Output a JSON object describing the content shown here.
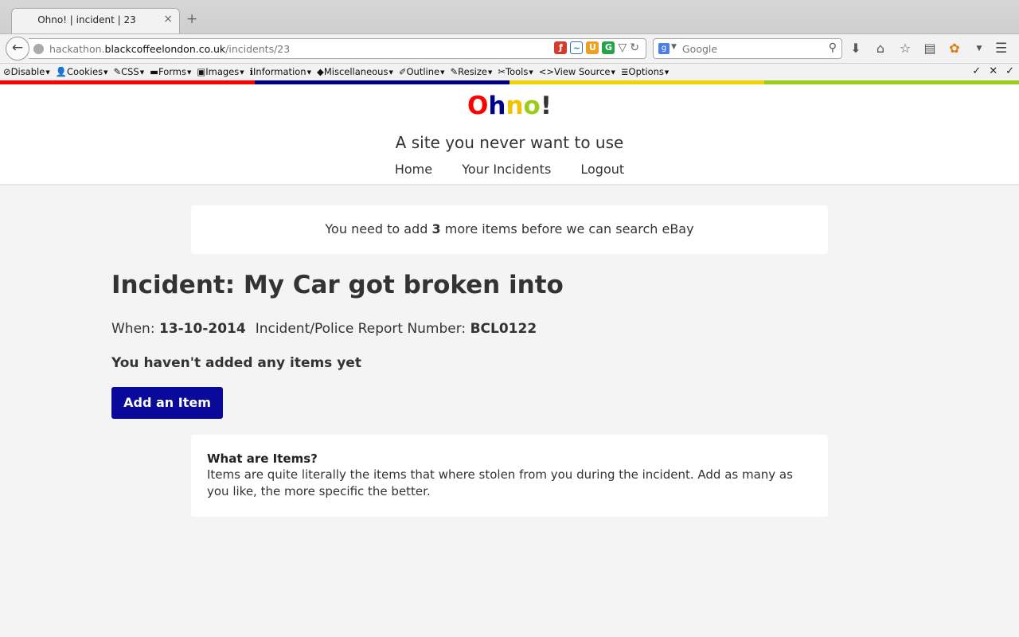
{
  "browser": {
    "tab_title": "Ohno! | incident | 23",
    "tab_close": "×",
    "new_tab": "+",
    "back": "←",
    "url": {
      "prefix": "hackathon.",
      "domain": "blackcoffeelondon.co.uk",
      "path": "/incidents/23"
    },
    "search_placeholder": "Google",
    "search_engine_letter": "g",
    "reload": "↻",
    "url_dropdown": "▽"
  },
  "dev_toolbar": {
    "items": [
      {
        "icon": "⊘",
        "label": "Disable"
      },
      {
        "icon": "👤",
        "label": "Cookies"
      },
      {
        "icon": "✎",
        "label": "CSS"
      },
      {
        "icon": "▬",
        "label": "Forms"
      },
      {
        "icon": "▣",
        "label": "Images"
      },
      {
        "icon": "ℹ",
        "label": "Information"
      },
      {
        "icon": "◆",
        "label": "Miscellaneous"
      },
      {
        "icon": "✐",
        "label": "Outline"
      },
      {
        "icon": "✎",
        "label": "Resize"
      },
      {
        "icon": "✂",
        "label": "Tools"
      },
      {
        "icon": "<>",
        "label": "View Source"
      },
      {
        "icon": "≣",
        "label": "Options"
      }
    ],
    "right": [
      "✓",
      "✕",
      "✓"
    ]
  },
  "strip_colors": [
    "#ff0000",
    "#00008b",
    "#f2d200",
    "#9ccc1a"
  ],
  "site": {
    "logo": {
      "o": "O",
      "h": "h",
      "n": "n",
      "o2": "o",
      "bang": "!"
    },
    "logo_colors": {
      "o": "#ff0000",
      "h": "#00008b",
      "n": "#f2c200",
      "o2": "#9ccc1a",
      "bang": "#333333"
    },
    "tagline": "A site you never want to use",
    "nav": [
      "Home",
      "Your Incidents",
      "Logout"
    ]
  },
  "notice": {
    "before": "You need to add ",
    "count": "3",
    "after": " more items before we can search eBay"
  },
  "incident": {
    "title": "Incident: My Car got broken into",
    "when_label": "When: ",
    "when_value": "13-10-2014",
    "report_label": "Incident/Police Report Number: ",
    "report_value": "BCL0122",
    "empty_message": "You haven't added any items yet",
    "add_button": "Add an Item"
  },
  "info": {
    "title": "What are Items?",
    "text": "Items are quite literally the items that where stolen from you during the incident. Add as many as you like, the more specific the better."
  }
}
